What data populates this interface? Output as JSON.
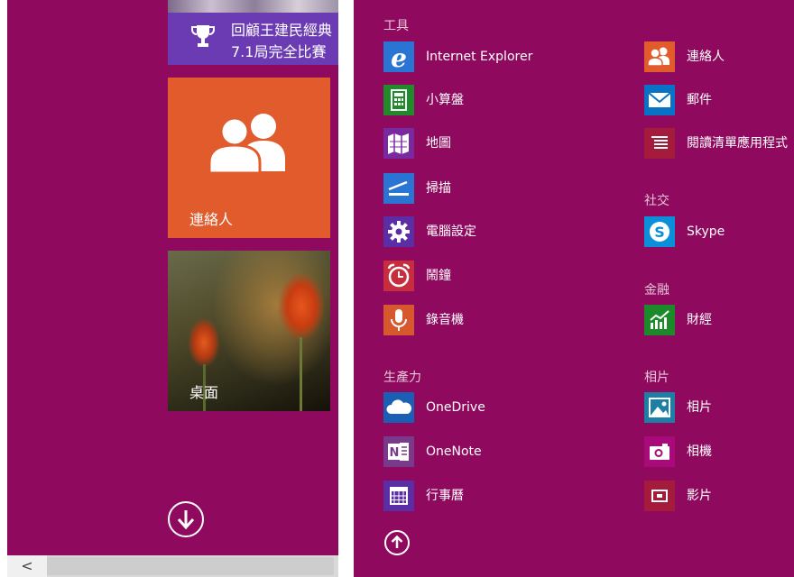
{
  "left_panel": {
    "news_tile": {
      "line1": "回顧王建民經典",
      "line2": "7.1局完全比賽"
    },
    "contacts_tile": {
      "label": "連絡人"
    },
    "desktop_tile": {
      "label": "桌面"
    },
    "scroll_left_glyph": "<"
  },
  "apps_view": {
    "groups": {
      "tools": "工具",
      "productivity": "生產力",
      "social": "社交",
      "finance": "金融",
      "photos": "相片"
    },
    "apps": {
      "internet_explorer": "Internet Explorer",
      "calculator": "小算盤",
      "maps": "地圖",
      "scan": "掃描",
      "pc_settings": "電腦設定",
      "alarms": "鬧鐘",
      "sound_recorder": "錄音機",
      "onedrive": "OneDrive",
      "onenote": "OneNote",
      "calendar": "行事曆",
      "people": "連絡人",
      "mail": "郵件",
      "reading_list": "閱讀清單應用程式",
      "skype": "Skype",
      "finance": "財經",
      "photos": "相片",
      "camera": "相機",
      "video": "影片"
    }
  },
  "colors": {
    "background": "#8f0a5f",
    "news_tile": "#6a3bb2",
    "contacts_tile": "#e25b2c",
    "ie_blue": "#2a74d3",
    "calculator_green": "#1f8b2b",
    "settings_purple": "#5b2ea6",
    "alarm_red": "#c72d3d",
    "recorder_orange": "#d8582e",
    "mail_blue": "#0a72c6",
    "reading_red": "#a51b3b",
    "finance_green": "#1d8a2a",
    "camera_magenta": "#a80a7a"
  }
}
